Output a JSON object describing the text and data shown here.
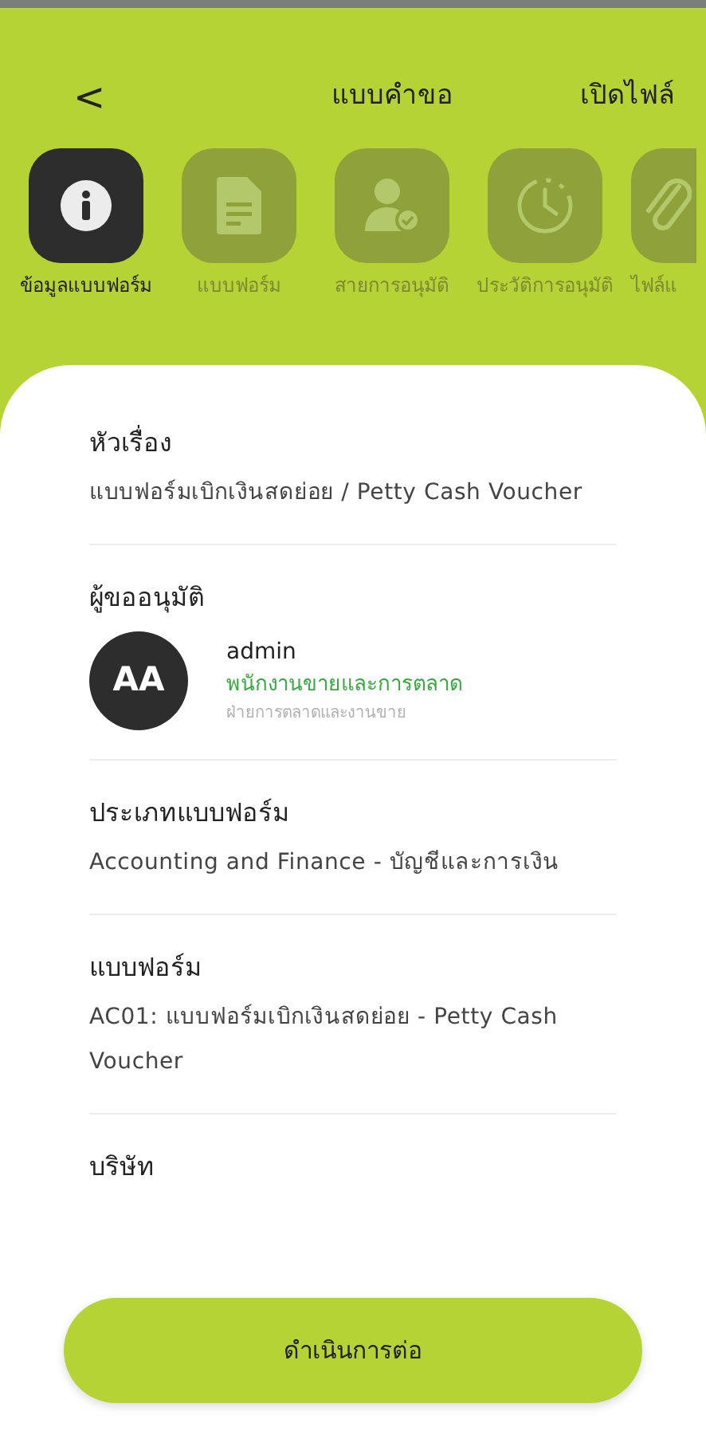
{
  "header": {
    "back": "<",
    "title": "แบบคำขอ",
    "action": "เปิดไฟล์"
  },
  "tabs": [
    {
      "label": "ข้อมูลแบบฟอร์ม",
      "selected": true
    },
    {
      "label": "แบบฟอร์ม",
      "selected": false
    },
    {
      "label": "สายการอนุมัติ",
      "selected": false
    },
    {
      "label": "ประวัติการอนุมัติ",
      "selected": false
    },
    {
      "label": "ไฟล์แ",
      "selected": false
    }
  ],
  "fields": [
    {
      "kind": "text",
      "label": "หัวเรื่อง",
      "value": "แบบฟอร์มเบิกเงินสดย่อย / Petty Cash Voucher"
    },
    {
      "kind": "person",
      "label": "ผู้ขออนุมัติ",
      "initials": "AA",
      "name": "admin",
      "position": "พนักงานขายและการตลาด",
      "department": "ฝ่ายการตลาดและงานขาย"
    },
    {
      "kind": "text",
      "label": "ประเภทแบบฟอร์ม",
      "value": "Accounting and Finance - บัญชีและการเงิน"
    },
    {
      "kind": "text",
      "label": "แบบฟอร์ม",
      "value": "AC01: แบบฟอร์มเบิกเงินสดย่อย - Petty Cash Voucher"
    },
    {
      "kind": "label",
      "label": "บริษัท"
    }
  ],
  "button": "ดำเนินการต่อ"
}
